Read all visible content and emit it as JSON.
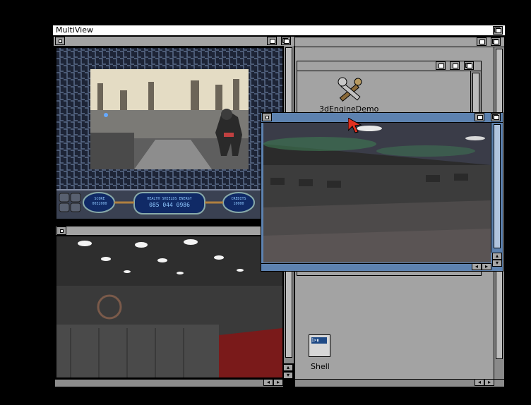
{
  "screen": {
    "title": "MultiView"
  },
  "icons": {
    "demo_label": "3dEngineDemo",
    "shell_label": "Shell",
    "shell_glyph": "1>▮"
  },
  "hud": {
    "score_label": "SCORE",
    "score_value": "0032000",
    "stats_labels": "HEALTH SHIELDS ENERGY",
    "stats_values": "085  044  0986",
    "credits_label": "CREDITS",
    "credits_value": "10000"
  },
  "colors": {
    "active_title": "#5d82b0",
    "window_grey": "#a0a0a0",
    "desktop": "#000000"
  }
}
